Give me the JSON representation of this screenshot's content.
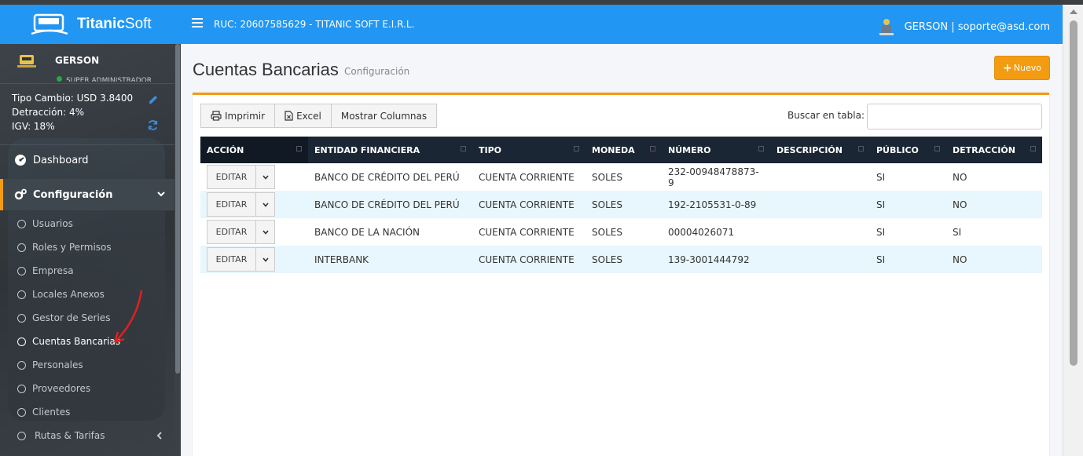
{
  "header": {
    "brand_bold": "Titanic",
    "brand_rest": "Soft",
    "ruc": "RUC: 20607585629 - TITANIC SOFT E.I.R.L.",
    "user": "GERSON | soporte@asd.com",
    "color": "#2196f3"
  },
  "sidebar": {
    "user_name": "GERSON",
    "user_role": "SUPER ADMINISTRADOR",
    "tipo_cambio": "Tipo Cambio: USD 3.8400",
    "detraccion": "Detracción: 4%",
    "igv": "IGV: 18%",
    "menu": [
      {
        "label": "Dashboard",
        "icon": "dashboard-icon"
      },
      {
        "label": "Configuración",
        "icon": "cogs-icon"
      }
    ],
    "subitems": [
      "Usuarios",
      "Roles y Permisos",
      "Empresa",
      "Locales Anexos",
      "Gestor de Series",
      "Cuentas Bancarias",
      "Personales",
      "Proveedores",
      "Clientes",
      "Rutas & Tarifas"
    ]
  },
  "page": {
    "title": "Cuentas Bancarias",
    "subtitle": "Configuración",
    "new_button": "Nuevo",
    "accent": "#f39c12"
  },
  "toolbar": {
    "print": "Imprimir",
    "excel": "Excel",
    "columns": "Mostrar Columnas",
    "search_label": "Buscar en tabla:",
    "search_value": ""
  },
  "table": {
    "columns": [
      "ACCIÓN",
      "ENTIDAD FINANCIERA",
      "TIPO",
      "MONEDA",
      "NÚMERO",
      "DESCRIPCIÓN",
      "PÚBLICO",
      "DETRACCIÓN"
    ],
    "edit_label": "EDITAR",
    "rows": [
      {
        "entidad": "BANCO DE CRÉDITO DEL PERÚ",
        "tipo": "CUENTA CORRIENTE",
        "moneda": "SOLES",
        "numero": "232-00948478873-9",
        "descripcion": "",
        "publico": "SI",
        "detraccion": "NO"
      },
      {
        "entidad": "BANCO DE CRÉDITO DEL PERÚ",
        "tipo": "CUENTA CORRIENTE",
        "moneda": "SOLES",
        "numero": "192-2105531-0-89",
        "descripcion": "",
        "publico": "SI",
        "detraccion": "NO"
      },
      {
        "entidad": "BANCO DE LA NACIÓN",
        "tipo": "CUENTA CORRIENTE",
        "moneda": "SOLES",
        "numero": "00004026071",
        "descripcion": "",
        "publico": "SI",
        "detraccion": "SI"
      },
      {
        "entidad": "INTERBANK",
        "tipo": "CUENTA CORRIENTE",
        "moneda": "SOLES",
        "numero": "139-3001444792",
        "descripcion": "",
        "publico": "SI",
        "detraccion": "NO"
      }
    ]
  }
}
